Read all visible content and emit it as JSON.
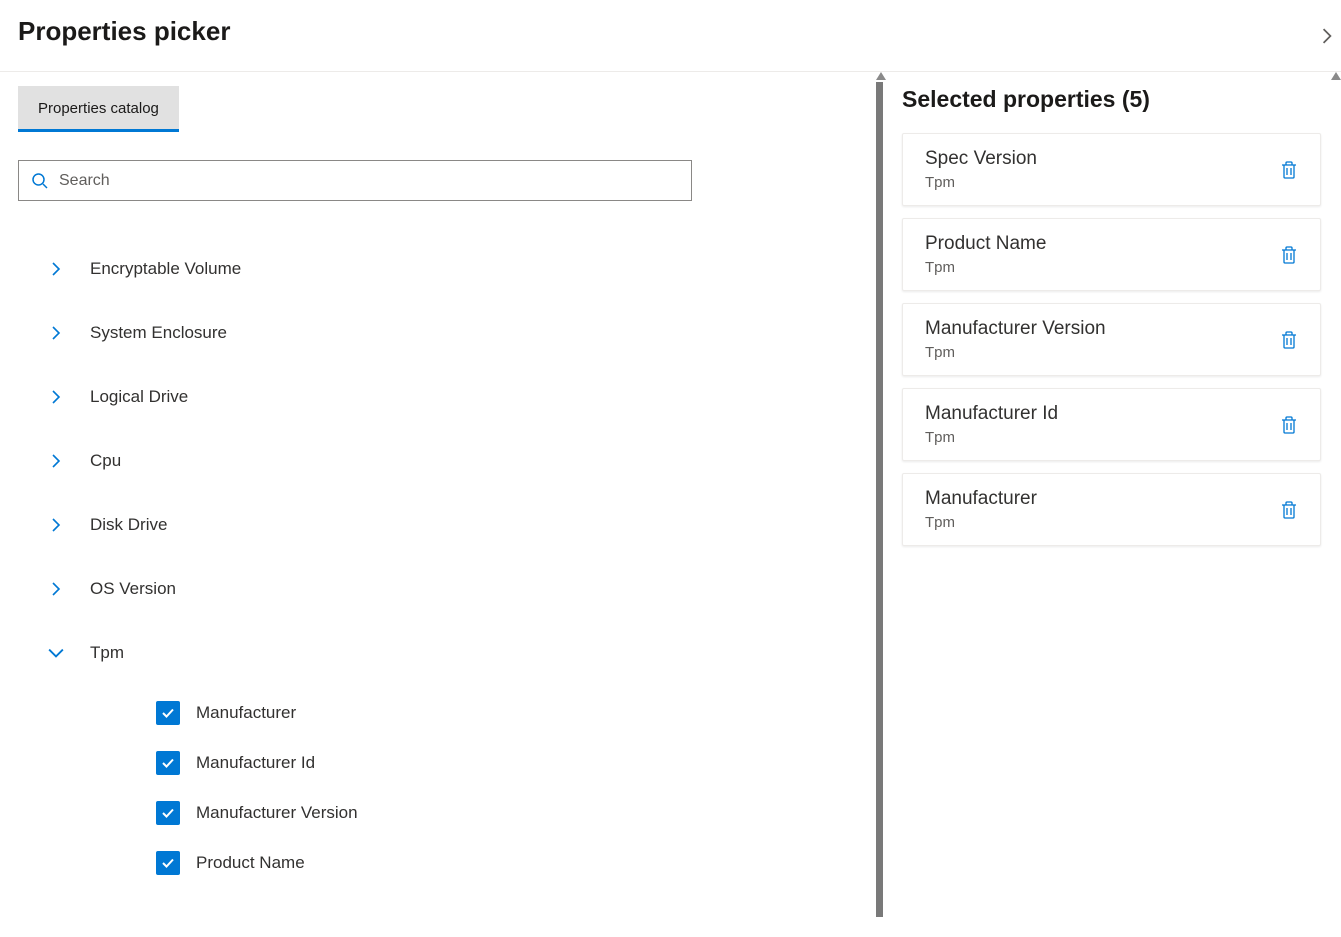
{
  "header": {
    "title": "Properties picker"
  },
  "tab": {
    "label": "Properties catalog"
  },
  "search": {
    "placeholder": "Search"
  },
  "tree": {
    "items": [
      {
        "label": "Encryptable Volume",
        "expanded": false
      },
      {
        "label": "System Enclosure",
        "expanded": false
      },
      {
        "label": "Logical Drive",
        "expanded": false
      },
      {
        "label": "Cpu",
        "expanded": false
      },
      {
        "label": "Disk Drive",
        "expanded": false
      },
      {
        "label": "OS Version",
        "expanded": false
      },
      {
        "label": "Tpm",
        "expanded": true,
        "children": [
          {
            "label": "Manufacturer",
            "checked": true
          },
          {
            "label": "Manufacturer Id",
            "checked": true
          },
          {
            "label": "Manufacturer Version",
            "checked": true
          },
          {
            "label": "Product Name",
            "checked": true
          }
        ]
      }
    ]
  },
  "selected": {
    "title": "Selected properties (5)",
    "items": [
      {
        "title": "Spec Version",
        "subtitle": "Tpm"
      },
      {
        "title": "Product Name",
        "subtitle": "Tpm"
      },
      {
        "title": "Manufacturer Version",
        "subtitle": "Tpm"
      },
      {
        "title": "Manufacturer Id",
        "subtitle": "Tpm"
      },
      {
        "title": "Manufacturer",
        "subtitle": "Tpm"
      }
    ]
  }
}
